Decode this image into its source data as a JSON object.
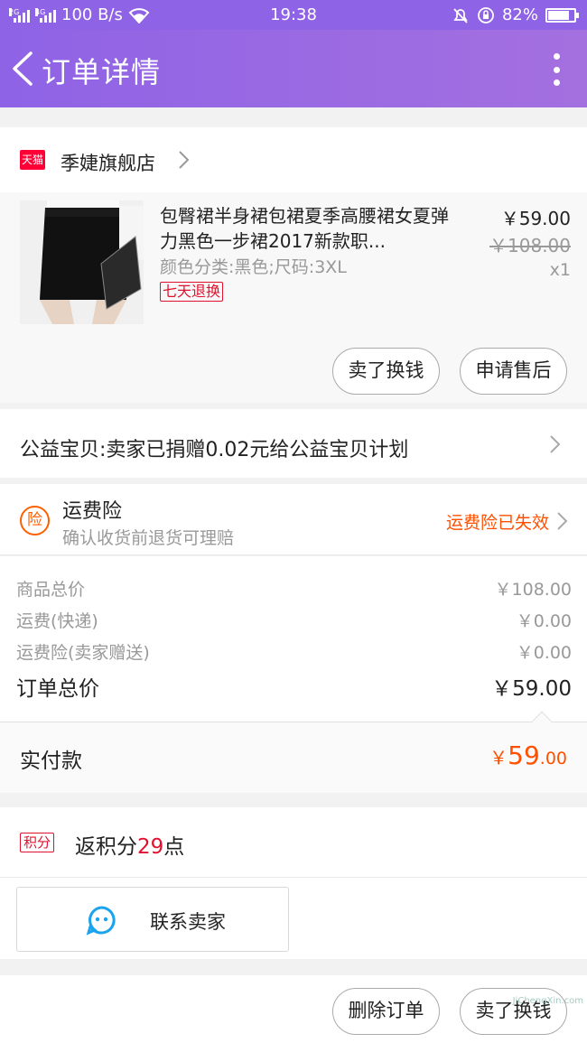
{
  "status_bar": {
    "net_labels": [
      "2G",
      "4G"
    ],
    "speed": "100 B/s",
    "time": "19:38",
    "battery": "82%",
    "battery_level": 0.82
  },
  "header": {
    "title": "订单详情"
  },
  "store": {
    "platform_badge": "天猫",
    "name": "季婕旗舰店"
  },
  "product": {
    "title": "包臀裙半身裙包裙夏季高腰裙女夏弹力黑色一步裙2017新款职...",
    "spec": "颜色分类:黑色;尺码:3XL",
    "tag": "七天退换",
    "price": "￥59.00",
    "original_price": "￥108.00",
    "quantity": "x1",
    "actions": [
      "卖了换钱",
      "申请售后"
    ]
  },
  "charity": {
    "text": "公益宝贝:卖家已捐赠0.02元给公益宝贝计划"
  },
  "insurance": {
    "icon_label": "险",
    "title": "运费险",
    "subtitle": "确认收货前退货可理赔",
    "status": "运费险已失效"
  },
  "summary": {
    "rows": [
      {
        "label": "商品总价",
        "value": "￥108.00"
      },
      {
        "label": "运费(快递)",
        "value": "￥0.00"
      },
      {
        "label": "运费险(卖家赠送)",
        "value": "￥0.00"
      }
    ],
    "total_label": "订单总价",
    "total_value": "￥59.00"
  },
  "paid": {
    "label": "实付款",
    "currency": "￥",
    "integer": "59",
    "decimal": ".00"
  },
  "points": {
    "badge": "积分",
    "prefix": "返积分",
    "count": "29",
    "suffix": "点"
  },
  "contact": {
    "label": "联系卖家"
  },
  "bottom_actions": [
    "删除订单",
    "卖了换钱"
  ],
  "watermark": "JiChengXin.com",
  "colors": {
    "header": "#8f63e6",
    "accent_orange": "#ff5000",
    "tmall_red": "#ff0036"
  }
}
